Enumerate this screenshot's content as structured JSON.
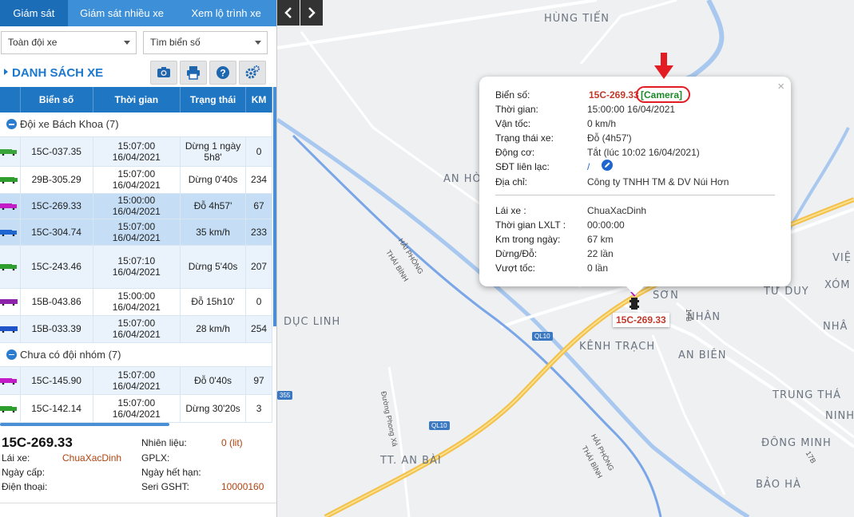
{
  "tabs": [
    "Giám sát",
    "Giám sát nhiều xe",
    "Xem lộ trình xe"
  ],
  "filters": {
    "fleet_select": "Toàn đội xe",
    "plate_search": "Tìm biển số"
  },
  "list": {
    "title": "DANH SÁCH XE"
  },
  "columns": [
    "Biển số",
    "Thời gian",
    "Trạng thái",
    "KM"
  ],
  "groups": [
    {
      "name": "Đội xe Bách Khoa (7)",
      "rows": [
        {
          "plate": "15C-037.35",
          "time": "15:07:00 16/04/2021",
          "status": "Dừng 1 ngày 5h8'",
          "km": "0",
          "color": "#3aa53a"
        },
        {
          "plate": "29B-305.29",
          "time": "15:07:00 16/04/2021",
          "status": "Dừng 0'40s",
          "km": "234",
          "color": "#2e9e2e"
        },
        {
          "plate": "15C-269.33",
          "time": "15:00:00 16/04/2021",
          "status": "Đỗ 4h57'",
          "km": "67",
          "color": "#c21bc7"
        },
        {
          "plate": "15C-304.74",
          "time": "15:07:00 16/04/2021",
          "status": "35 km/h",
          "km": "233",
          "color": "#1f66d1"
        },
        {
          "plate": "15C-243.46",
          "time": "15:07:10 16/04/2021",
          "status": "Dừng 5'40s",
          "km": "207",
          "color": "#2e9e2e"
        },
        {
          "plate": "15B-043.86",
          "time": "15:00:00 16/04/2021",
          "status": "Đỗ 15h10'",
          "km": "0",
          "color": "#8e24aa"
        },
        {
          "plate": "15B-033.39",
          "time": "15:07:00 16/04/2021",
          "status": "28 km/h",
          "km": "254",
          "color": "#1f55c9"
        }
      ]
    },
    {
      "name": "Chưa có đội nhóm (7)",
      "rows": [
        {
          "plate": "15C-145.90",
          "time": "15:07:00 16/04/2021",
          "status": "Đỗ 0'40s",
          "km": "97",
          "color": "#c21bc7"
        },
        {
          "plate": "15C-142.14",
          "time": "15:07:00 16/04/2021",
          "status": "Dừng 30'20s",
          "km": "3",
          "color": "#2e9e2e"
        }
      ]
    }
  ],
  "detail": {
    "plate": "15C-269.33",
    "driver_label": "Lái xe:",
    "driver": "ChuaXacDinh",
    "issue_label": "Ngày cấp:",
    "phone_label": "Điện thoại:",
    "fuel_label": "Nhiên liệu:",
    "fuel": "0 (lit)",
    "gplx_label": "GPLX:",
    "expiry_label": "Ngày hết hạn:",
    "gsht_label": "Seri GSHT:",
    "gsht": "10000160"
  },
  "popup": {
    "plate_label": "Biển số:",
    "plate": "15C-269.33",
    "camera": "[Camera]",
    "time_label": "Thời gian:",
    "time": "15:00:00 16/04/2021",
    "speed_label": "Vận tốc:",
    "speed": "0 km/h",
    "state_label": "Trạng thái xe:",
    "state": "Đỗ (4h57')",
    "engine_label": "Động cơ:",
    "engine": "Tắt (lúc 10:02 16/04/2021)",
    "contact_label": "SĐT liên lạc:",
    "contact": "/",
    "address_label": "Địa chỉ:",
    "address": "Công ty TNHH TM & DV Núi Hơn",
    "driver_label": "Lái xe :",
    "driver": "ChuaXacDinh",
    "lxlt_label": "Thời gian LXLT :",
    "lxlt": "00:00:00",
    "km_label": "Km trong ngày:",
    "km": "67 km",
    "stops_label": "Dừng/Đỗ:",
    "stops": "22 lần",
    "overspeed_label": "Vượt tốc:",
    "overspeed": "0 lần"
  },
  "map": {
    "marker_label": "15C-269.33",
    "places": [
      "HÙNG TIẾN",
      "AN HÒ",
      "DỤC LINH",
      "SƠN",
      "NHÂN",
      "KÊNH TRẠCH",
      "AN BIÊN",
      "TƯ DUY",
      "VIỆ",
      "XÓM",
      "NHÂ",
      "TRUNG THÁ",
      "NINH",
      "ĐÔNG MINH",
      "BẢO HÀ",
      "TT. AN BÀI"
    ],
    "roads": [
      "HẢI PHÒNG",
      "THÁI BÌNH",
      "Đường Phong Xá",
      "HẢI PHÒNG",
      "THÁI BÌNH"
    ],
    "shields": [
      "QL10",
      "QL10",
      "355",
      "17B",
      "17B"
    ]
  }
}
